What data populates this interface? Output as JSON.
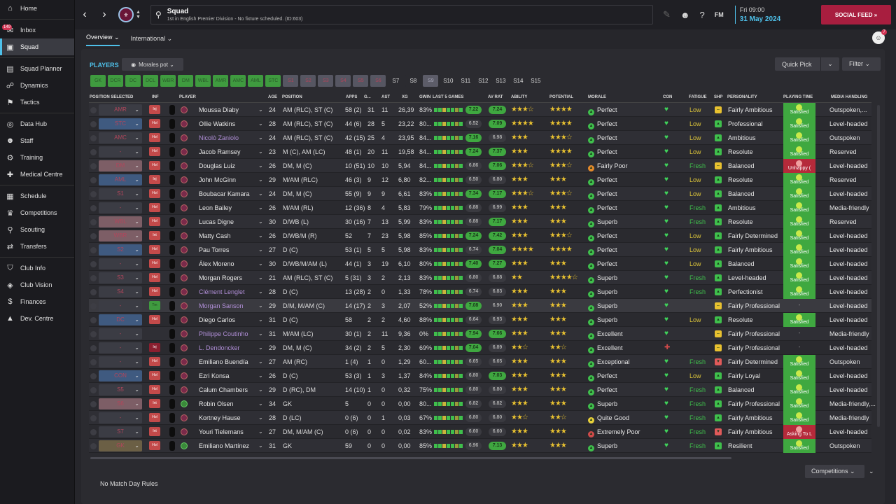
{
  "sidebar": {
    "inbox_badge": "149",
    "items": [
      {
        "label": "Home",
        "icon": "home-icon"
      },
      {
        "label": "Inbox",
        "icon": "inbox-icon"
      },
      {
        "label": "Squad",
        "icon": "shirt-icon",
        "active": true
      },
      {
        "label": "Squad Planner",
        "icon": "planner-icon"
      },
      {
        "label": "Dynamics",
        "icon": "dynamics-icon"
      },
      {
        "label": "Tactics",
        "icon": "tactics-icon"
      },
      {
        "label": "Data Hub",
        "icon": "datahub-icon"
      },
      {
        "label": "Staff",
        "icon": "staff-icon"
      },
      {
        "label": "Training",
        "icon": "training-icon"
      },
      {
        "label": "Medical Centre",
        "icon": "medical-icon"
      },
      {
        "label": "Schedule",
        "icon": "calendar-icon"
      },
      {
        "label": "Competitions",
        "icon": "trophy-icon"
      },
      {
        "label": "Scouting",
        "icon": "scouting-icon"
      },
      {
        "label": "Transfers",
        "icon": "transfers-icon"
      },
      {
        "label": "Club Info",
        "icon": "shield-icon"
      },
      {
        "label": "Club Vision",
        "icon": "vision-icon"
      },
      {
        "label": "Finances",
        "icon": "finances-icon"
      },
      {
        "label": "Dev. Centre",
        "icon": "dev-icon"
      }
    ]
  },
  "header": {
    "title": "Squad",
    "subtitle": "1st in English Premier Division - No fixture scheduled. (ID:603)",
    "fm": "FM",
    "day": "Fri 09:00",
    "date": "31 May 2024",
    "social": "SOCIAL FEED »",
    "avatar_badge": "7"
  },
  "tabs": [
    {
      "label": "Overview ⌄"
    },
    {
      "label": "International ⌄"
    }
  ],
  "players_title": "PLAYERS",
  "morales_button": "Morales pot ⌄",
  "quick_pick": "Quick Pick",
  "filter": "Filter ⌄",
  "position_buttons": [
    {
      "l": "GK",
      "c": "g"
    },
    {
      "l": "DCR",
      "c": "g"
    },
    {
      "l": "DC",
      "c": "g"
    },
    {
      "l": "DCL",
      "c": "g"
    },
    {
      "l": "WBR",
      "c": "g"
    },
    {
      "l": "DM",
      "c": "g"
    },
    {
      "l": "WBL",
      "c": "g"
    },
    {
      "l": "AMR",
      "c": "g"
    },
    {
      "l": "AMC",
      "c": "g"
    },
    {
      "l": "AML",
      "c": "g"
    },
    {
      "l": "STC",
      "c": "g"
    },
    {
      "l": "S1",
      "c": "r"
    },
    {
      "l": "S2",
      "c": "r"
    },
    {
      "l": "S3",
      "c": "r"
    },
    {
      "l": "S4",
      "c": "r"
    },
    {
      "l": "S5",
      "c": "r"
    },
    {
      "l": "S6",
      "c": "r"
    },
    {
      "l": "S7",
      "c": "s"
    },
    {
      "l": "S8",
      "c": "s"
    },
    {
      "l": "S9",
      "c": "sh"
    },
    {
      "l": "S10",
      "c": "s"
    },
    {
      "l": "S11",
      "c": "s"
    },
    {
      "l": "S12",
      "c": "s"
    },
    {
      "l": "S13",
      "c": "s"
    },
    {
      "l": "S14",
      "c": "s"
    },
    {
      "l": "S15",
      "c": "s"
    }
  ],
  "columns": {
    "possel": "POSITION SELECTED",
    "inf": "INF",
    "player": "PLAYER",
    "age": "AGE",
    "position": "POSITION",
    "apps": "APPS",
    "gls": "G...",
    "ast": "AST",
    "xg": "XG",
    "gw": "GWIN",
    "last5": "LAST 5 GAMES",
    "avrat": "AV RAT",
    "ability": "ABILITY",
    "potential": "POTENTIAL",
    "morale": "MORALE",
    "con": "CON",
    "fatigue": "FATIGUE",
    "shp": "SHP",
    "personality": "PERSONALITY",
    "playing": "PLAYING TIME",
    "media": "MEDIA HANDLING"
  },
  "players": [
    {
      "ps": "AMR",
      "pc": "",
      "inf": "Inj",
      "name": "Moussa Diaby",
      "age": "24",
      "pos": "AM (RLC), ST (C)",
      "apps": "58 (2)",
      "g": "31",
      "a": "11",
      "xg": "26,39",
      "gw": "83%",
      "l5": "7.22",
      "av": "7.24",
      "ab": "★★★☆",
      "pot": "★★★★",
      "mor": "Perfect",
      "mi": "g",
      "con": "♥",
      "fat": "Low",
      "shp": "y",
      "pers": "Fairly Ambitious",
      "pt": "Satisfied",
      "ptc": "g",
      "media": "Outspoken,..."
    },
    {
      "ps": "STC",
      "pc": "blue",
      "inf": "Hol",
      "name": "Ollie Watkins",
      "age": "28",
      "pos": "AM (RLC), ST (C)",
      "apps": "44 (6)",
      "g": "28",
      "a": "5",
      "xg": "23,22",
      "gw": "80...",
      "l5": "6.52",
      "av": "7.09",
      "ab": "★★★★",
      "pot": "★★★★",
      "mor": "Perfect",
      "mi": "g",
      "con": "♥",
      "fat": "Low",
      "shp": "g",
      "pers": "Professional",
      "pt": "Satisfied",
      "ptc": "g",
      "media": "Level-headed"
    },
    {
      "ps": "AMC",
      "pc": "",
      "inf": "Hol",
      "name": "Nicolò Zaniolo",
      "sel": true,
      "age": "24",
      "pos": "AM (RLC), ST (C)",
      "apps": "42 (15)",
      "g": "25",
      "a": "4",
      "xg": "23,95",
      "gw": "84...",
      "l5": "7.16",
      "av": "6.98",
      "ab": "★★★",
      "pot": "★★★☆",
      "mor": "Perfect",
      "mi": "g",
      "con": "♥",
      "fat": "Low",
      "shp": "g",
      "pers": "Ambitious",
      "pt": "Satisfied",
      "ptc": "g",
      "media": "Outspoken"
    },
    {
      "ps": "-",
      "pc": "",
      "inf": "Hol",
      "name": "Jacob Ramsey",
      "age": "23",
      "pos": "M (C), AM (LC)",
      "apps": "48 (1)",
      "g": "20",
      "a": "11",
      "xg": "19,58",
      "gw": "84...",
      "l5": "7.24",
      "av": "7.37",
      "ab": "★★★",
      "pot": "★★★★",
      "mor": "Perfect",
      "mi": "g",
      "con": "♥",
      "fat": "Low",
      "shp": "g",
      "pers": "Resolute",
      "pt": "Satisfied",
      "ptc": "g",
      "media": "Reserved"
    },
    {
      "ps": "DM",
      "pc": "pink",
      "inf": "Hol",
      "name": "Douglas Luiz",
      "age": "26",
      "pos": "DM, M (C)",
      "apps": "10 (51)",
      "g": "10",
      "a": "10",
      "xg": "5,94",
      "gw": "84...",
      "l5": "6.86",
      "av": "7.06",
      "ab": "★★★☆",
      "pot": "★★★☆",
      "mor": "Fairly Poor",
      "mi": "o",
      "con": "♥",
      "fat": "Fresh",
      "shp": "y",
      "pers": "Balanced",
      "pt": "Unhappy (",
      "ptc": "r",
      "media": "Level-headed"
    },
    {
      "ps": "AML",
      "pc": "blue",
      "inf": "Inj",
      "name": "John McGinn",
      "age": "29",
      "pos": "M/AM (RLC)",
      "apps": "46 (3)",
      "g": "9",
      "a": "12",
      "xg": "6,80",
      "gw": "82...",
      "l5": "6.50",
      "av": "6.80",
      "ab": "★★★",
      "pot": "★★★",
      "mor": "Perfect",
      "mi": "g",
      "con": "♥",
      "fat": "Low",
      "shp": "g",
      "pers": "Resolute",
      "pt": "Satisfied",
      "ptc": "g",
      "media": "Reserved"
    },
    {
      "ps": "S1",
      "pc": "",
      "inf": "Hol",
      "name": "Boubacar Kamara",
      "age": "24",
      "pos": "DM, M (C)",
      "apps": "55 (9)",
      "g": "9",
      "a": "9",
      "xg": "6,61",
      "gw": "83%",
      "l5": "7.34",
      "av": "7.17",
      "ab": "★★★☆",
      "pot": "★★★☆",
      "mor": "Perfect",
      "mi": "g",
      "con": "♥",
      "fat": "Low",
      "shp": "g",
      "pers": "Balanced",
      "pt": "Satisfied",
      "ptc": "g",
      "media": "Level-headed"
    },
    {
      "ps": "-",
      "pc": "",
      "inf": "Hol",
      "name": "Leon Bailey",
      "age": "26",
      "pos": "M/AM (RL)",
      "apps": "12 (36)",
      "g": "8",
      "a": "4",
      "xg": "5,83",
      "gw": "79%",
      "l5": "6.88",
      "av": "6.99",
      "ab": "★★★",
      "pot": "★★★",
      "mor": "Perfect",
      "mi": "g",
      "con": "♥",
      "fat": "Fresh",
      "shp": "g",
      "pers": "Ambitious",
      "pt": "Satisfied",
      "ptc": "g",
      "media": "Media-friendly"
    },
    {
      "ps": "WBL",
      "pc": "pink",
      "inf": "Hol",
      "name": "Lucas Digne",
      "age": "30",
      "pos": "D/WB (L)",
      "apps": "30 (16)",
      "g": "7",
      "a": "13",
      "xg": "5,99",
      "gw": "83%",
      "l5": "6.88",
      "av": "7.17",
      "ab": "★★★",
      "pot": "★★★",
      "mor": "Superb",
      "mi": "g",
      "con": "♥",
      "fat": "Fresh",
      "shp": "g",
      "pers": "Resolute",
      "pt": "Satisfied",
      "ptc": "g",
      "media": "Reserved"
    },
    {
      "ps": "WBR",
      "pc": "pink",
      "inf": "Int",
      "name": "Matty Cash",
      "age": "26",
      "pos": "D/WB/M (R)",
      "apps": "52",
      "g": "7",
      "a": "23",
      "xg": "5,98",
      "gw": "85%",
      "l5": "7.24",
      "av": "7.42",
      "ab": "★★★",
      "pot": "★★★☆",
      "mor": "Perfect",
      "mi": "g",
      "con": "♥",
      "fat": "Low",
      "shp": "g",
      "pers": "Fairly Determined",
      "pt": "Satisfied",
      "ptc": "g",
      "media": "Level-headed"
    },
    {
      "ps": "S2",
      "pc": "blue",
      "inf": "Hol",
      "name": "Pau Torres",
      "age": "27",
      "pos": "D (C)",
      "apps": "53 (1)",
      "g": "5",
      "a": "5",
      "xg": "5,98",
      "gw": "83%",
      "l5": "6.74",
      "av": "7.04",
      "ab": "★★★★",
      "pot": "★★★★",
      "mor": "Perfect",
      "mi": "g",
      "con": "♥",
      "fat": "Low",
      "shp": "g",
      "pers": "Fairly Ambitious",
      "pt": "Satisfied",
      "ptc": "g",
      "media": "Level-headed"
    },
    {
      "ps": "-",
      "pc": "",
      "inf": "Hol",
      "name": "Álex Moreno",
      "age": "30",
      "pos": "D/WB/M/AM (L)",
      "apps": "44 (1)",
      "g": "3",
      "a": "19",
      "xg": "6,10",
      "gw": "80%",
      "l5": "7.40",
      "av": "7.27",
      "ab": "★★★",
      "pot": "★★★",
      "mor": "Perfect",
      "mi": "g",
      "con": "♥",
      "fat": "Low",
      "shp": "g",
      "pers": "Balanced",
      "pt": "Satisfied",
      "ptc": "g",
      "media": "Level-headed"
    },
    {
      "ps": "S3",
      "pc": "",
      "inf": "Hol",
      "name": "Morgan Rogers",
      "age": "21",
      "pos": "AM (RLC), ST (C)",
      "apps": "5 (31)",
      "g": "3",
      "a": "2",
      "xg": "2,13",
      "gw": "83%",
      "l5": "6.80",
      "av": "6.88",
      "ab": "★★",
      "pot": "★★★★☆",
      "mor": "Superb",
      "mi": "g",
      "con": "♥",
      "fat": "Fresh",
      "shp": "g",
      "pers": "Level-headed",
      "pt": "Satisfied",
      "ptc": "g",
      "media": "Level-headed"
    },
    {
      "ps": "S4",
      "pc": "",
      "inf": "Hol",
      "name": "Clément Lenglet",
      "sel": true,
      "age": "28",
      "pos": "D (C)",
      "apps": "13 (28)",
      "g": "2",
      "a": "0",
      "xg": "1,33",
      "gw": "78%",
      "l5": "6.74",
      "av": "6.83",
      "ab": "★★★",
      "pot": "★★★",
      "mor": "Superb",
      "mi": "g",
      "con": "♥",
      "fat": "Fresh",
      "shp": "g",
      "pers": "Perfectionist",
      "pt": "Satisfied",
      "ptc": "g",
      "media": "Level-headed"
    },
    {
      "ps": "-",
      "pc": "",
      "inf": "Tm",
      "infc": "grn",
      "name": "Morgan Sanson",
      "sel": true,
      "hl": true,
      "age": "29",
      "pos": "D/M, M/AM (C)",
      "apps": "14 (17)",
      "g": "2",
      "a": "3",
      "xg": "2,07",
      "gw": "52%",
      "l5": "7.08",
      "av": "6.90",
      "ab": "★★★",
      "pot": "★★★",
      "mor": "Superb",
      "mi": "g",
      "con": "♥",
      "fat": "",
      "shp": "y",
      "pers": "Fairly Professional",
      "pt": "-",
      "ptc": "none",
      "media": "Level-headed"
    },
    {
      "ps": "DC",
      "pc": "blue",
      "inf": "Hol",
      "name": "Diego Carlos",
      "age": "31",
      "pos": "D (C)",
      "apps": "58",
      "g": "2",
      "a": "2",
      "xg": "4,60",
      "gw": "88%",
      "l5": "6.64",
      "av": "6.93",
      "ab": "★★★",
      "pot": "★★★",
      "mor": "Superb",
      "mi": "g",
      "con": "♥",
      "fat": "Low",
      "shp": "g",
      "pers": "Resolute",
      "pt": "Satisfied",
      "ptc": "g",
      "media": "Level-headed"
    },
    {
      "ps": "-",
      "pc": "",
      "inf": "",
      "name": "Philippe Coutinho",
      "sel": true,
      "age": "31",
      "pos": "M/AM (LC)",
      "apps": "30 (1)",
      "g": "2",
      "a": "11",
      "xg": "9,36",
      "gw": "0%",
      "l5": "7.94",
      "av": "7.66",
      "ab": "★★★",
      "pot": "★★★",
      "mor": "Excellent",
      "mi": "g",
      "con": "♥",
      "fat": "",
      "shp": "y",
      "pers": "Fairly Professional",
      "pt": "-",
      "ptc": "none",
      "media": "Media-friendly"
    },
    {
      "ps": "-",
      "pc": "",
      "inf": "Inj",
      "infc": "dark",
      "name": "L. Dendoncker",
      "sel": true,
      "age": "29",
      "pos": "DM, M (C)",
      "apps": "34 (2)",
      "g": "2",
      "a": "5",
      "xg": "2,30",
      "gw": "69%",
      "l5": "7.04",
      "av": "6.89",
      "ab": "★★☆",
      "pot": "★★☆",
      "mor": "Excellent",
      "mi": "g",
      "con": "✚",
      "fat": "",
      "shp": "y",
      "pers": "Fairly Professional",
      "pt": "-",
      "ptc": "none",
      "media": "Level-headed"
    },
    {
      "ps": "-",
      "pc": "",
      "inf": "Hol",
      "name": "Emiliano Buendía",
      "age": "27",
      "pos": "AM (RC)",
      "apps": "1 (4)",
      "g": "1",
      "a": "0",
      "xg": "1,29",
      "gw": "60...",
      "l5": "6.65",
      "av": "6.65",
      "ab": "★★★",
      "pot": "★★★",
      "mor": "Exceptional",
      "mi": "g",
      "con": "♥",
      "fat": "Fresh",
      "shp": "r",
      "pers": "Fairly Determined",
      "pt": "Satisfied",
      "ptc": "g",
      "media": "Outspoken"
    },
    {
      "ps": "CON",
      "pc": "blue",
      "inf": "Hol",
      "name": "Ezri Konsa",
      "age": "26",
      "pos": "D (C)",
      "apps": "53 (3)",
      "g": "1",
      "a": "3",
      "xg": "1,37",
      "gw": "84%",
      "l5": "6.80",
      "av": "7.03",
      "ab": "★★★",
      "pot": "★★★",
      "mor": "Perfect",
      "mi": "g",
      "con": "♥",
      "fat": "Low",
      "shp": "g",
      "pers": "Fairly Loyal",
      "pt": "Satisfied",
      "ptc": "g",
      "media": "Level-headed"
    },
    {
      "ps": "S5",
      "pc": "",
      "inf": "Hol",
      "name": "Calum Chambers",
      "age": "29",
      "pos": "D (RC), DM",
      "apps": "14 (10)",
      "g": "1",
      "a": "0",
      "xg": "0,32",
      "gw": "75%",
      "l5": "6.80",
      "av": "6.80",
      "ab": "★★★",
      "pot": "★★★",
      "mor": "Perfect",
      "mi": "g",
      "con": "♥",
      "fat": "Fresh",
      "shp": "g",
      "pers": "Balanced",
      "pt": "Satisfied",
      "ptc": "g",
      "media": "Level-headed"
    },
    {
      "ps": "S6",
      "pc": "pink",
      "inf": "Int",
      "name": "Robin Olsen",
      "gk": true,
      "age": "34",
      "pos": "GK",
      "apps": "5",
      "g": "0",
      "a": "0",
      "xg": "0,00",
      "gw": "80...",
      "l5": "6.82",
      "av": "6.82",
      "ab": "★★★",
      "pot": "★★★",
      "mor": "Superb",
      "mi": "g",
      "con": "♥",
      "fat": "Fresh",
      "shp": "g",
      "pers": "Fairly Professional",
      "pt": "Satisfied",
      "ptc": "g",
      "media": "Media-friendly,..."
    },
    {
      "ps": "-",
      "pc": "",
      "inf": "Hol",
      "name": "Kortney Hause",
      "age": "28",
      "pos": "D (LC)",
      "apps": "0 (6)",
      "g": "0",
      "a": "1",
      "xg": "0,03",
      "gw": "67%",
      "l5": "6.80",
      "av": "6.80",
      "ab": "★★☆",
      "pot": "★★☆",
      "mor": "Quite Good",
      "mi": "y",
      "con": "♥",
      "fat": "Fresh",
      "shp": "g",
      "pers": "Fairly Ambitious",
      "pt": "Satisfied",
      "ptc": "g",
      "media": "Media-friendly"
    },
    {
      "ps": "S7",
      "pc": "",
      "inf": "Int",
      "name": "Youri Tielemans",
      "age": "27",
      "pos": "DM, M/AM (C)",
      "apps": "0 (6)",
      "g": "0",
      "a": "0",
      "xg": "0,02",
      "gw": "83%",
      "l5": "6.60",
      "av": "6.60",
      "ab": "★★★",
      "pot": "★★★",
      "mor": "Extremely Poor",
      "mi": "r",
      "con": "♥",
      "fat": "Fresh",
      "shp": "r",
      "pers": "Fairly Ambitious",
      "pt": "Asking To L",
      "ptc": "r",
      "media": "Level-headed"
    },
    {
      "ps": "GK",
      "pc": "gold",
      "inf": "Hol",
      "name": "Emiliano Martínez",
      "gk": true,
      "age": "31",
      "pos": "GK",
      "apps": "59",
      "g": "0",
      "a": "0",
      "xg": "0,00",
      "gw": "85%",
      "l5": "6.96",
      "av": "7.13",
      "ab": "★★★",
      "pot": "★★★",
      "mor": "Superb",
      "mi": "g",
      "con": "♥",
      "fat": "Fresh",
      "shp": "g",
      "pers": "Resilient",
      "pt": "Satisfied",
      "ptc": "g",
      "media": "Outspoken"
    }
  ],
  "footer": {
    "competitions": "Competitions ⌄",
    "no_rules": "No Match Day Rules"
  }
}
